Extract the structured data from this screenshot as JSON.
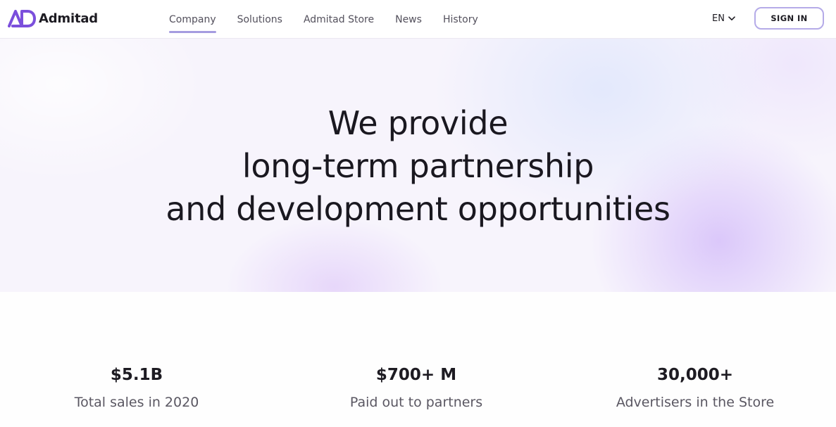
{
  "brand": {
    "name": "Admitad",
    "mark_color": "#7b4fdc"
  },
  "nav": {
    "items": [
      {
        "label": "Company",
        "active": true
      },
      {
        "label": "Solutions",
        "active": false
      },
      {
        "label": "Admitad Store",
        "active": false
      },
      {
        "label": "News",
        "active": false
      },
      {
        "label": "History",
        "active": false
      }
    ],
    "active_underline_color": "#a59ce0"
  },
  "header": {
    "language": "EN",
    "language_icon": "chevron-down-icon",
    "sign_in_label": "SIGN IN",
    "sign_in_border_color": "#b5abe8"
  },
  "hero": {
    "title_lines": [
      "We provide",
      "long-term partnership",
      "and development opportunities"
    ]
  },
  "stats": [
    {
      "value": "$5.1B",
      "label": "Total sales in 2020"
    },
    {
      "value": "$700+ M",
      "label": "Paid out to partners"
    },
    {
      "value": "30,000+",
      "label": "Advertisers in the Store"
    }
  ]
}
